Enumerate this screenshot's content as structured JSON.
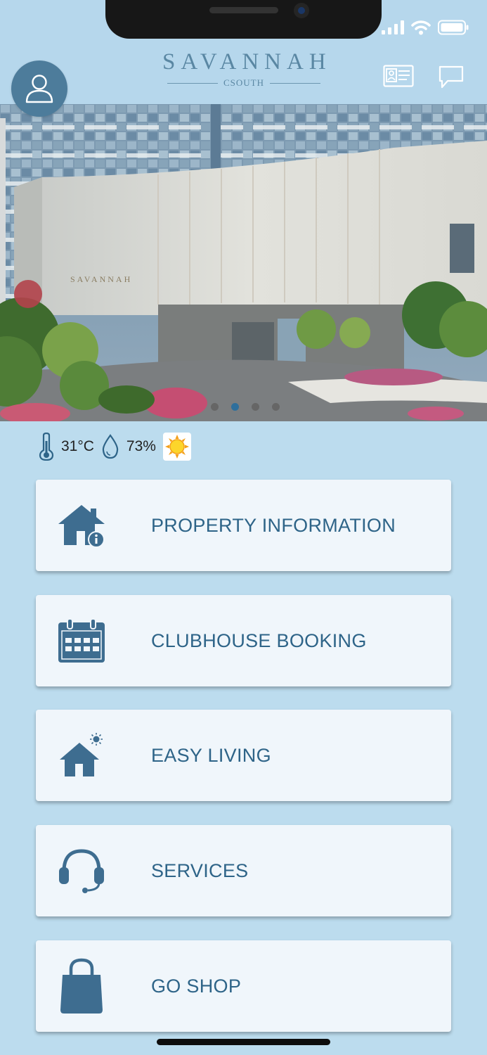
{
  "brand": {
    "name": "SAVANNAH",
    "sub": "CSOUTH"
  },
  "hero": {
    "sign_text": "SAVANNAH",
    "slides": 4,
    "active_slide": 2
  },
  "weather": {
    "temperature": "31°C",
    "humidity": "73%",
    "condition_icon": "sun-icon"
  },
  "menu": [
    {
      "label": "PROPERTY INFORMATION",
      "icon": "house-info-icon"
    },
    {
      "label": "CLUBHOUSE BOOKING",
      "icon": "calendar-icon"
    },
    {
      "label": "EASY LIVING",
      "icon": "house-sun-icon"
    },
    {
      "label": "SERVICES",
      "icon": "headset-icon"
    },
    {
      "label": "GO SHOP",
      "icon": "shopping-bag-icon"
    }
  ],
  "colors": {
    "accent": "#2e6488",
    "background": "#bcdcee",
    "card": "#f0f6fb"
  }
}
